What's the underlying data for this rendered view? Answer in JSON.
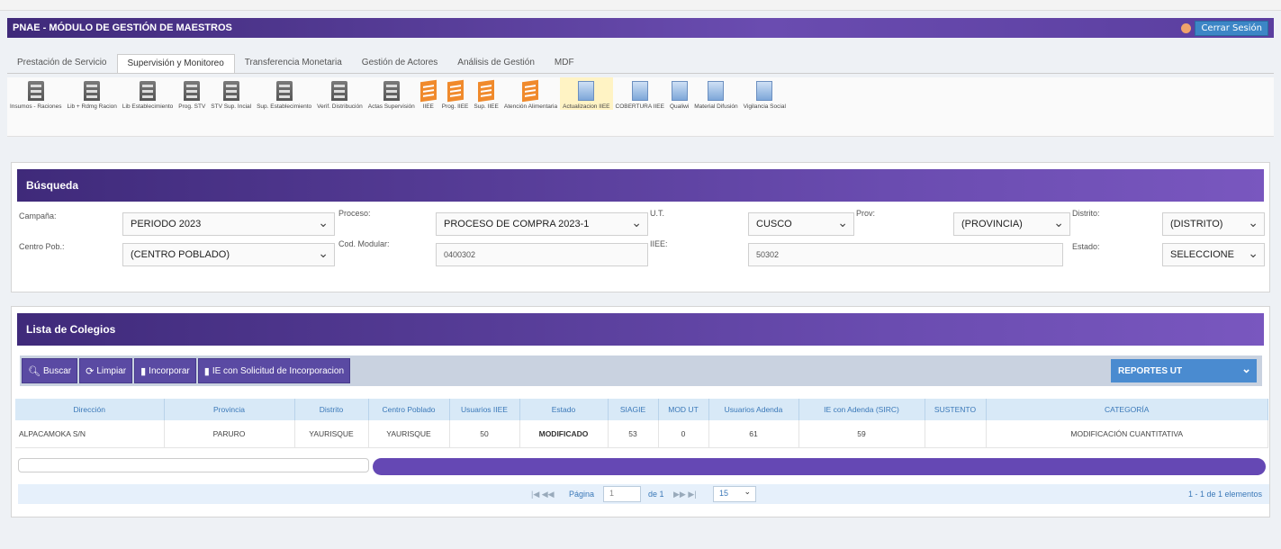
{
  "app": {
    "title": "PNAE - MÓDULO DE GESTIÓN DE MAESTROS",
    "logout_label": "Cerrar Sesión"
  },
  "tabs": [
    {
      "label": "Prestación de Servicio",
      "active": false
    },
    {
      "label": "Supervisión y Monitoreo",
      "active": true
    },
    {
      "label": "Transferencia Monetaria",
      "active": false
    },
    {
      "label": "Gestión de Actores",
      "active": false
    },
    {
      "label": "Análisis de Gestión",
      "active": false
    },
    {
      "label": "MDF",
      "active": false
    }
  ],
  "toolbar": [
    {
      "label": "Insumos - Raciones",
      "icon": "building-icon"
    },
    {
      "label": "Lib + Rdmg Racion",
      "icon": "building-icon"
    },
    {
      "label": "Lib Establecimiento",
      "icon": "building-icon"
    },
    {
      "label": "Prog. STV",
      "icon": "building-icon"
    },
    {
      "label": "STV Sup. Incial",
      "icon": "building-icon"
    },
    {
      "label": "Sup. Establecimiento",
      "icon": "building-icon"
    },
    {
      "label": "Verif. Distribución",
      "icon": "building-icon"
    },
    {
      "label": "Actas Supervisión",
      "icon": "building-icon"
    },
    {
      "label": "IIEE",
      "icon": "orange-form-icon"
    },
    {
      "label": "Prog. IIEE",
      "icon": "orange-form-icon"
    },
    {
      "label": "Sup. IIEE",
      "icon": "orange-form-icon"
    },
    {
      "label": "Atención Alimentaria",
      "icon": "orange-form-icon"
    },
    {
      "label": "Actualizacion IIEE",
      "icon": "blue-document-icon",
      "selected": true
    },
    {
      "label": "COBERTURA IIEE",
      "icon": "blue-document-icon"
    },
    {
      "label": "Qualiwi",
      "icon": "blue-document-icon"
    },
    {
      "label": "Material Difusión",
      "icon": "blue-document-icon"
    },
    {
      "label": "Vigilancia Social",
      "icon": "blue-document-icon"
    }
  ],
  "search": {
    "title": "Búsqueda",
    "labels": {
      "campana": "Campaña:",
      "proceso": "Proceso:",
      "ut": "U.T.",
      "prov": "Prov:",
      "distrito": "Distrito:",
      "centro_pob": "Centro Pob.:",
      "cod_modular": "Cod. Modular:",
      "iiee": "IIEE:",
      "estado": "Estado:"
    },
    "values": {
      "campana": "PERIODO 2023",
      "proceso": "PROCESO DE COMPRA 2023-1",
      "ut": "CUSCO",
      "prov": "(PROVINCIA)",
      "distrito": "(DISTRITO)",
      "centro_pob": "(CENTRO POBLADO)",
      "cod_modular": "0400302",
      "iiee": "50302",
      "estado": "SELECCIONE"
    }
  },
  "list": {
    "title": "Lista de Colegios",
    "buttons": {
      "buscar": "Buscar",
      "limpiar": "Limpiar",
      "incorporar": "Incorporar",
      "solicitud": "IE con Solicitud de Incorporacion"
    },
    "report_select": "REPORTES UT",
    "columns": [
      "Dirección",
      "Provincia",
      "Distrito",
      "Centro Poblado",
      "Usuarios IIEE",
      "Estado",
      "SIAGIE",
      "MOD UT",
      "Usuarios Adenda",
      "IE con Adenda (SIRC)",
      "SUSTENTO",
      "CATEGORÍA"
    ],
    "rows": [
      [
        "ALPACAMOKA S/N",
        "PARURO",
        "YAURISQUE",
        "YAURISQUE",
        "50",
        "MODIFICADO",
        "53",
        "0",
        "61",
        "59",
        "",
        "MODIFICACIÓN CUANTITATIVA"
      ]
    ],
    "pager": {
      "nav_prev": "|◀ ◀◀",
      "page_label": "Página",
      "page_value": "1",
      "of_label": "de 1",
      "nav_next": "▶▶ ▶|",
      "page_size": "15",
      "summary": "1 - 1 de 1 elementos"
    }
  }
}
